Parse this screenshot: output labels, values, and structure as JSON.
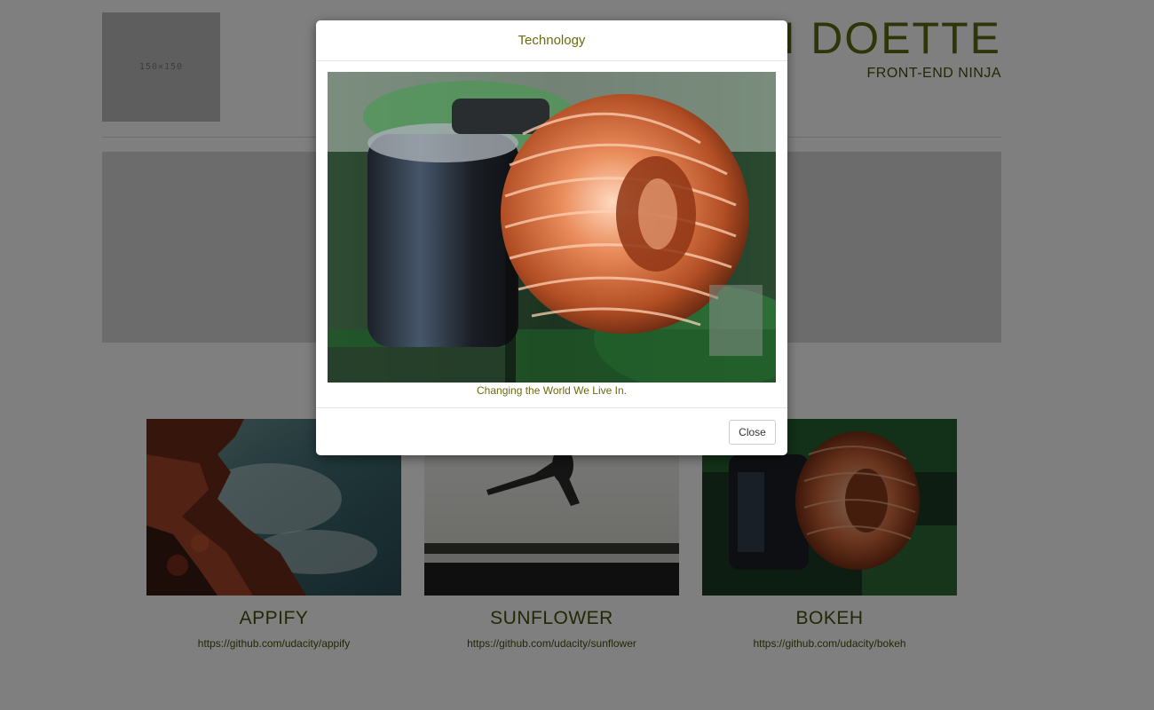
{
  "header": {
    "logo_placeholder": "150×150",
    "name": "N DOETTE",
    "subtitle": "FRONT-END NINJA"
  },
  "projects": [
    {
      "title": "APPIFY",
      "link": "https://github.com/udacity/appify",
      "image": "rocky-coast-photo"
    },
    {
      "title": "SUNFLOWER",
      "link": "https://github.com/udacity/sunflower",
      "image": "jumping-person-silhouette-photo"
    },
    {
      "title": "BOKEH",
      "link": "https://github.com/udacity/bokeh",
      "image": "copper-coil-circuit-photo"
    }
  ],
  "modal": {
    "title": "Technology",
    "caption": "Changing the World We Live In.",
    "close_label": "Close",
    "image": "copper-coil-circuit-photo"
  },
  "colors": {
    "accent": "#5c6a12",
    "overlay": "rgba(0,0,0,0.5)"
  }
}
